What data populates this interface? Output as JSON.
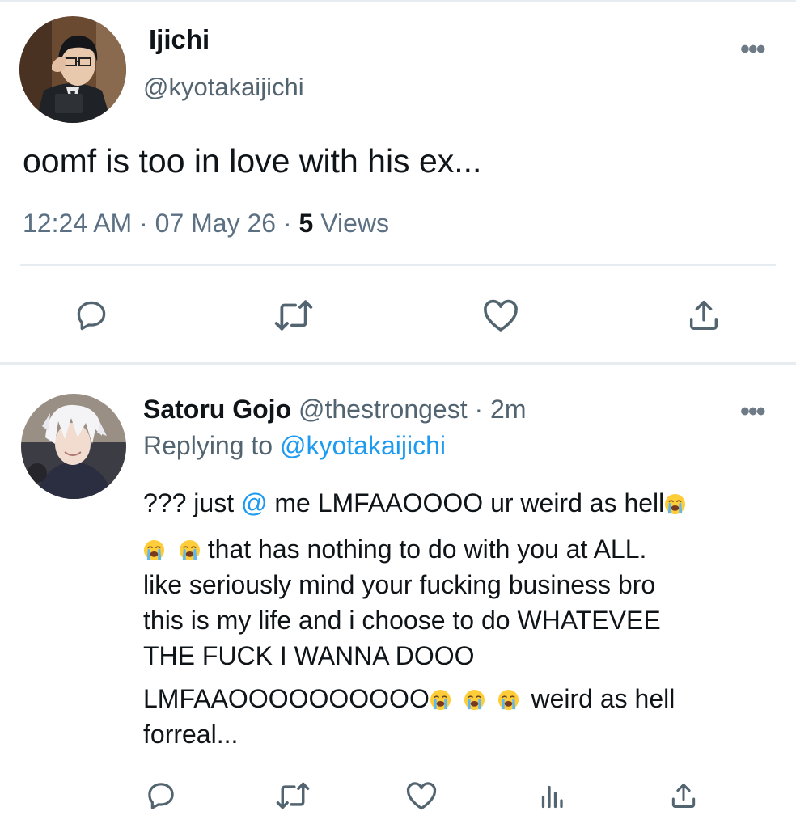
{
  "tweet": {
    "name": "Ijichi",
    "handle": "@kyotakaijichi",
    "text": "oomf is too in love with his ex...",
    "time": "12:24 AM",
    "date": "07 May 26",
    "views_count": "5",
    "views_label": "Views",
    "sep": "·"
  },
  "reply": {
    "name": "Satoru Gojo",
    "handle": "@thestrongest",
    "age": "2m",
    "sep": "·",
    "replying_prefix": "Replying to",
    "replying_handle": "@kyotakaijichi",
    "line1_a": "??? just ",
    "line1_mention": "@",
    "line1_b": " me LMFAAOOOO ur weird as hell",
    "line2": " that has nothing to do with you at ALL.",
    "line3": "like seriously mind your fucking business bro",
    "line4": "this is my life and i choose to do WHATEVEE",
    "line5": "THE FUCK I WANNA DOOO",
    "line6_a": "LMFAAOOOOOOOOOO",
    "line6_b": " weird as hell",
    "line7": "forreal..."
  },
  "icons": {
    "more": "more-icon",
    "reply": "reply-icon",
    "retweet": "retweet-icon",
    "like": "heart-icon",
    "share": "share-icon",
    "analytics": "analytics-icon",
    "emoji": "loudly-crying-face-emoji"
  },
  "colors": {
    "link": "#1d9bf0",
    "secondary": "#536471",
    "divider": "#e6ecf0"
  }
}
